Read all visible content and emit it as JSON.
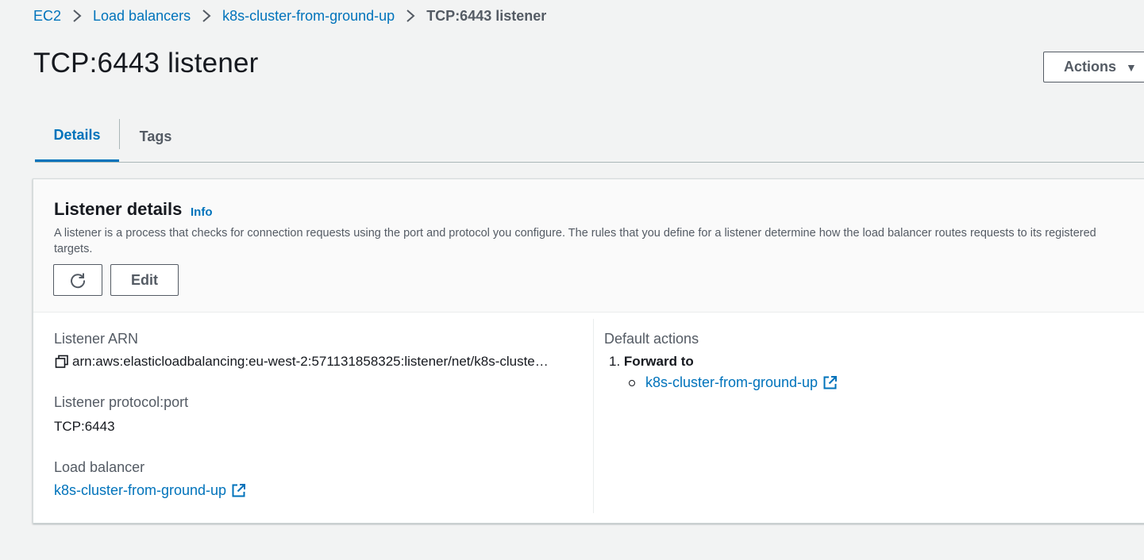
{
  "breadcrumb": {
    "items": [
      "EC2",
      "Load balancers",
      "k8s-cluster-from-ground-up"
    ],
    "current": "TCP:6443 listener"
  },
  "header": {
    "title": "TCP:6443 listener",
    "actions_label": "Actions"
  },
  "tabs": [
    {
      "label": "Details",
      "active": true
    },
    {
      "label": "Tags",
      "active": false
    }
  ],
  "panel": {
    "title": "Listener details",
    "info_label": "Info",
    "description": "A listener is a process that checks for connection requests using the port and protocol you configure. The rules that you define for a listener determine how the load balancer routes requests to its registered targets.",
    "edit_label": "Edit"
  },
  "fields": {
    "arn_label": "Listener ARN",
    "arn_value": "arn:aws:elasticloadbalancing:eu-west-2:571131858325:listener/net/k8s-cluste…",
    "protocol_label": "Listener protocol:port",
    "protocol_value": "TCP:6443",
    "lb_label": "Load balancer",
    "lb_value": "k8s-cluster-from-ground-up",
    "default_actions_label": "Default actions",
    "action_num": "1.",
    "action_title": "Forward to",
    "action_target": "k8s-cluster-from-ground-up"
  },
  "colors": {
    "link": "#0073bb",
    "text": "#16191f",
    "muted": "#545b64",
    "background": "#f2f3f3"
  },
  "icons": [
    "chevron-right-icon",
    "caret-down-icon",
    "refresh-icon",
    "copy-icon",
    "external-link-icon"
  ]
}
